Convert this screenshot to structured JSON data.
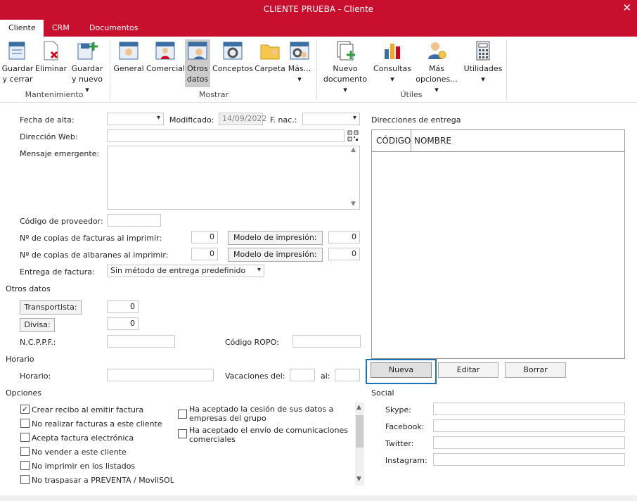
{
  "window": {
    "title": "CLIENTE PRUEBA - Cliente",
    "close": "✕"
  },
  "tabs": [
    "Cliente",
    "CRM",
    "Documentos"
  ],
  "ribbon": {
    "mantenimiento": {
      "label": "Mantenimiento",
      "buttons": [
        [
          "Guardar",
          "y cerrar"
        ],
        [
          "Eliminar",
          ""
        ],
        [
          "Guardar",
          "y nuevo ▾"
        ]
      ]
    },
    "mostrar": {
      "label": "Mostrar",
      "buttons": [
        [
          "General",
          ""
        ],
        [
          "Comercial",
          ""
        ],
        [
          "Otros",
          "datos"
        ],
        [
          "Conceptos",
          ""
        ],
        [
          "Carpeta",
          ""
        ],
        [
          "Más...",
          "▾"
        ]
      ]
    },
    "utiles": {
      "label": "Útiles",
      "buttons": [
        [
          "Nuevo",
          "documento ▾"
        ],
        [
          "Consultas",
          "▾"
        ],
        [
          "Más",
          "opciones... ▾"
        ],
        [
          "Utilidades",
          "▾"
        ]
      ]
    }
  },
  "form": {
    "fecha_alta": {
      "label": "Fecha de alta:",
      "value": ""
    },
    "modificado": {
      "label": "Modificado:",
      "value": "14/09/2022"
    },
    "f_nac": {
      "label": "F. nac.:",
      "value": ""
    },
    "direccion_web": {
      "label": "Dirección Web:",
      "value": ""
    },
    "mensaje": {
      "label": "Mensaje emergente:",
      "value": ""
    },
    "codigo_proveedor": {
      "label": "Código de proveedor:",
      "value": ""
    },
    "copias_facturas": {
      "label": "Nº de copias de facturas al imprimir:",
      "value": "0",
      "modelo_label": "Modelo de impresión:",
      "modelo_value": "0"
    },
    "copias_albaranes": {
      "label": "Nº de copias de albaranes al imprimir:",
      "value": "0",
      "modelo_label": "Modelo de impresión:",
      "modelo_value": "0"
    },
    "entrega_factura": {
      "label": "Entrega de factura:",
      "value": "Sin método de entrega predefinido"
    }
  },
  "otros_datos": {
    "title": "Otros datos",
    "transportista": {
      "label": "Transportista:",
      "value": "0"
    },
    "divisa": {
      "label": "Divisa:",
      "value": "0"
    },
    "ncppf": {
      "label": "N.C.P.P.F.:",
      "value": ""
    },
    "codigo_ropo": {
      "label": "Código ROPO:",
      "value": ""
    }
  },
  "horario": {
    "title": "Horario",
    "horario": {
      "label": "Horario:",
      "value": ""
    },
    "vacaciones": {
      "label": "Vacaciones del:",
      "value": ""
    },
    "al": {
      "label": "al:",
      "value": ""
    }
  },
  "opciones": {
    "title": "Opciones",
    "left": [
      {
        "label": "Crear recibo al emitir factura",
        "checked": "✓"
      },
      {
        "label": "No realizar facturas a este cliente",
        "checked": ""
      },
      {
        "label": "Acepta factura electrónica",
        "checked": ""
      },
      {
        "label": "No vender a este cliente",
        "checked": ""
      },
      {
        "label": "No imprimir en los listados",
        "checked": ""
      },
      {
        "label": "No traspasar a PREVENTA / MovilSOL",
        "checked": ""
      }
    ],
    "right": [
      {
        "line1": "Ha aceptado la cesión de sus datos a",
        "line2": "empresas del grupo",
        "checked": ""
      },
      {
        "line1": "Ha aceptado el envío de comunicaciones",
        "line2": "comerciales",
        "checked": ""
      }
    ]
  },
  "direcciones": {
    "title": "Direcciones de entrega",
    "columns": [
      "CÓDIGO",
      "NOMBRE"
    ],
    "buttons": {
      "nueva": "Nueva",
      "editar": "Editar",
      "borrar": "Borrar"
    }
  },
  "social": {
    "title": "Social",
    "fields": [
      {
        "label": "Skype:",
        "value": ""
      },
      {
        "label": "Facebook:",
        "value": ""
      },
      {
        "label": "Twitter:",
        "value": ""
      },
      {
        "label": "Instagram:",
        "value": ""
      }
    ]
  },
  "colors": {
    "brand": "#c8102e",
    "focus": "#1a73b8"
  }
}
